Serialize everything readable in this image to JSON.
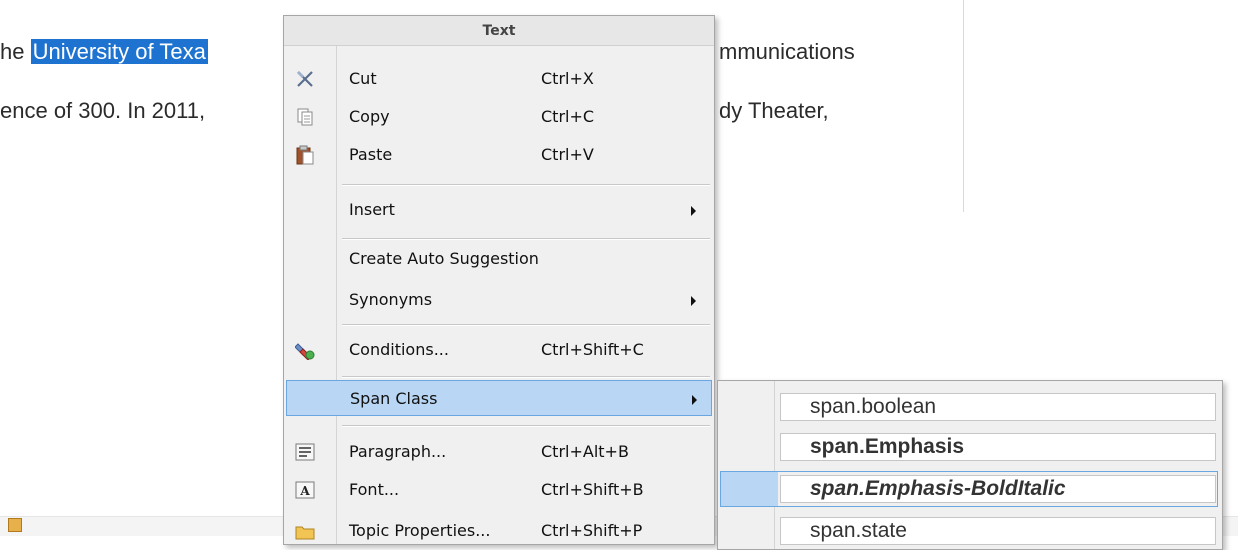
{
  "document": {
    "line1_pre": "he ",
    "line1_selected": "University of Texa",
    "line1_post": "mmunications",
    "line2_pre": "ence of 300. In 2011,",
    "line2_post": "dy Theater,"
  },
  "context_menu": {
    "title": "Text",
    "items": [
      {
        "label": "Cut",
        "shortcut": "Ctrl+X",
        "icon": "scissors-icon"
      },
      {
        "label": "Copy",
        "shortcut": "Ctrl+C",
        "icon": "copy-icon"
      },
      {
        "label": "Paste",
        "shortcut": "Ctrl+V",
        "icon": "paste-icon"
      },
      {
        "label": "Insert",
        "shortcut": "",
        "icon": ""
      },
      {
        "label": "Create Auto Suggestion",
        "shortcut": "",
        "icon": ""
      },
      {
        "label": "Synonyms",
        "shortcut": "",
        "icon": ""
      },
      {
        "label": "Conditions...",
        "shortcut": "Ctrl+Shift+C",
        "icon": "conditions-icon"
      },
      {
        "label": "Span Class",
        "shortcut": "",
        "icon": ""
      },
      {
        "label": "Paragraph...",
        "shortcut": "Ctrl+Alt+B",
        "icon": "paragraph-icon"
      },
      {
        "label": "Font...",
        "shortcut": "Ctrl+Shift+B",
        "icon": "font-icon"
      },
      {
        "label": "Topic Properties...",
        "shortcut": "Ctrl+Shift+P",
        "icon": "folder-icon"
      }
    ]
  },
  "span_class_submenu": {
    "items": [
      "span.boolean",
      "span.Emphasis",
      "span.Emphasis-BoldItalic",
      "span.state"
    ]
  },
  "colors": {
    "selection": "#1e73d0",
    "highlight": "#b9d7f4",
    "highlight_border": "#6aa7e0",
    "menu_bg": "#f0f0f0"
  }
}
